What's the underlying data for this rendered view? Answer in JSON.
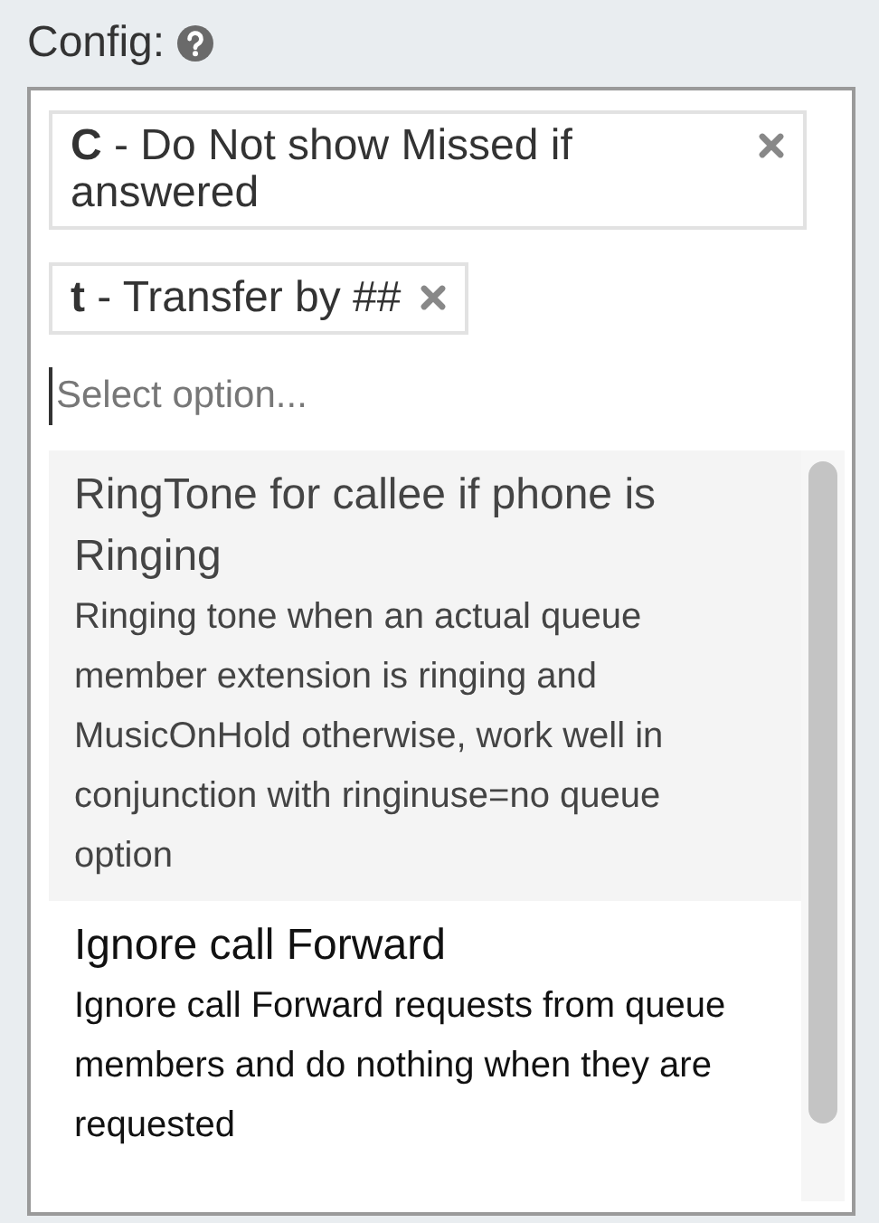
{
  "label": "Config:",
  "chips": [
    {
      "key": "C",
      "text": " - Do Not show Missed if answered"
    },
    {
      "key": "t",
      "text": " - Transfer by ##"
    }
  ],
  "search": {
    "placeholder": "Select option..."
  },
  "options": [
    {
      "title": "RingTone for callee if phone is Ringing",
      "description": "Ringing tone when an actual queue member extension is ringing and MusicOnHold otherwise, work well in conjunction with ringinuse=no queue option",
      "selected": true
    },
    {
      "title": "Ignore call Forward",
      "description": "Ignore call Forward requests from queue members and do nothing when they are requested",
      "selected": false
    }
  ]
}
